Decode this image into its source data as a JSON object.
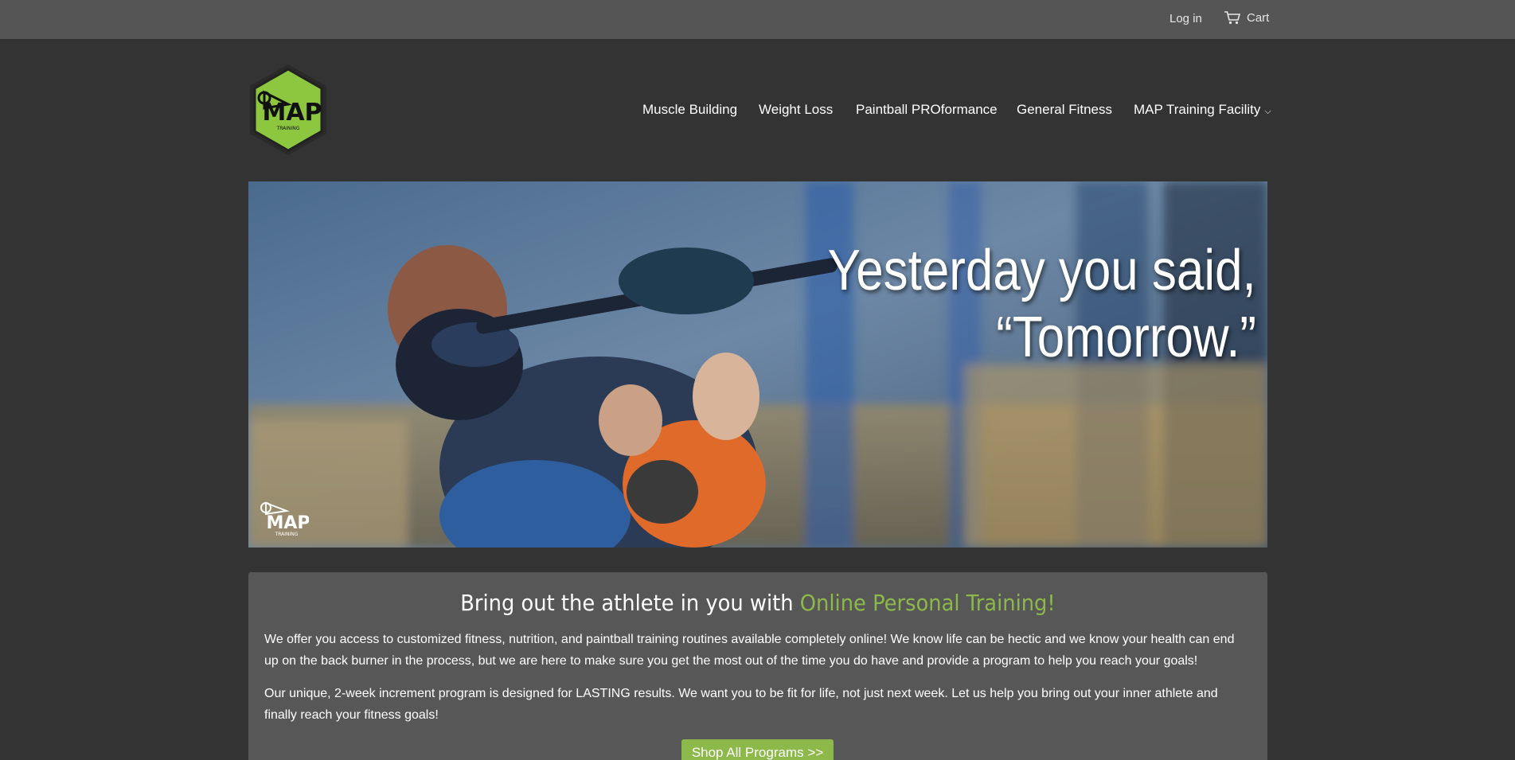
{
  "topbar": {
    "login_label": "Log in",
    "cart_label": "Cart"
  },
  "logo": {
    "brand": "MAP",
    "sub": "TRAINING"
  },
  "nav": {
    "items": [
      {
        "label": "Muscle Building"
      },
      {
        "label": "Weight Loss"
      },
      {
        "label": "Paintball PROformance"
      },
      {
        "label": "General Fitness"
      },
      {
        "label": "MAP Training Facility",
        "chevron": "⌵"
      }
    ]
  },
  "hero": {
    "line1": "Yesterday you said,",
    "line2": "“Tomorrow.”",
    "watermark": "MAP",
    "watermark_sub": "TRAINING"
  },
  "intro": {
    "headline_lead": "Bring out the athlete in you with ",
    "headline_accent": "Online Personal Training!",
    "paragraph1": "We offer you access to customized fitness, nutrition, and paintball training routines available completely online! We know life can be hectic and we know your health can end up on the back burner in the process, but we are here to make sure you get the most out of the time you do have and provide a program to help you reach your goals!",
    "paragraph2": "Our unique, 2-week increment program is designed for LASTING results. We want you to be fit for life, not just next week. Let us help you bring out your inner athlete and finally reach your fitness goals!",
    "button_label": "Shop All Programs >>"
  },
  "colors": {
    "accent": "#8db84a",
    "background": "#333333",
    "topbar": "#555555",
    "panel": "#575757"
  }
}
